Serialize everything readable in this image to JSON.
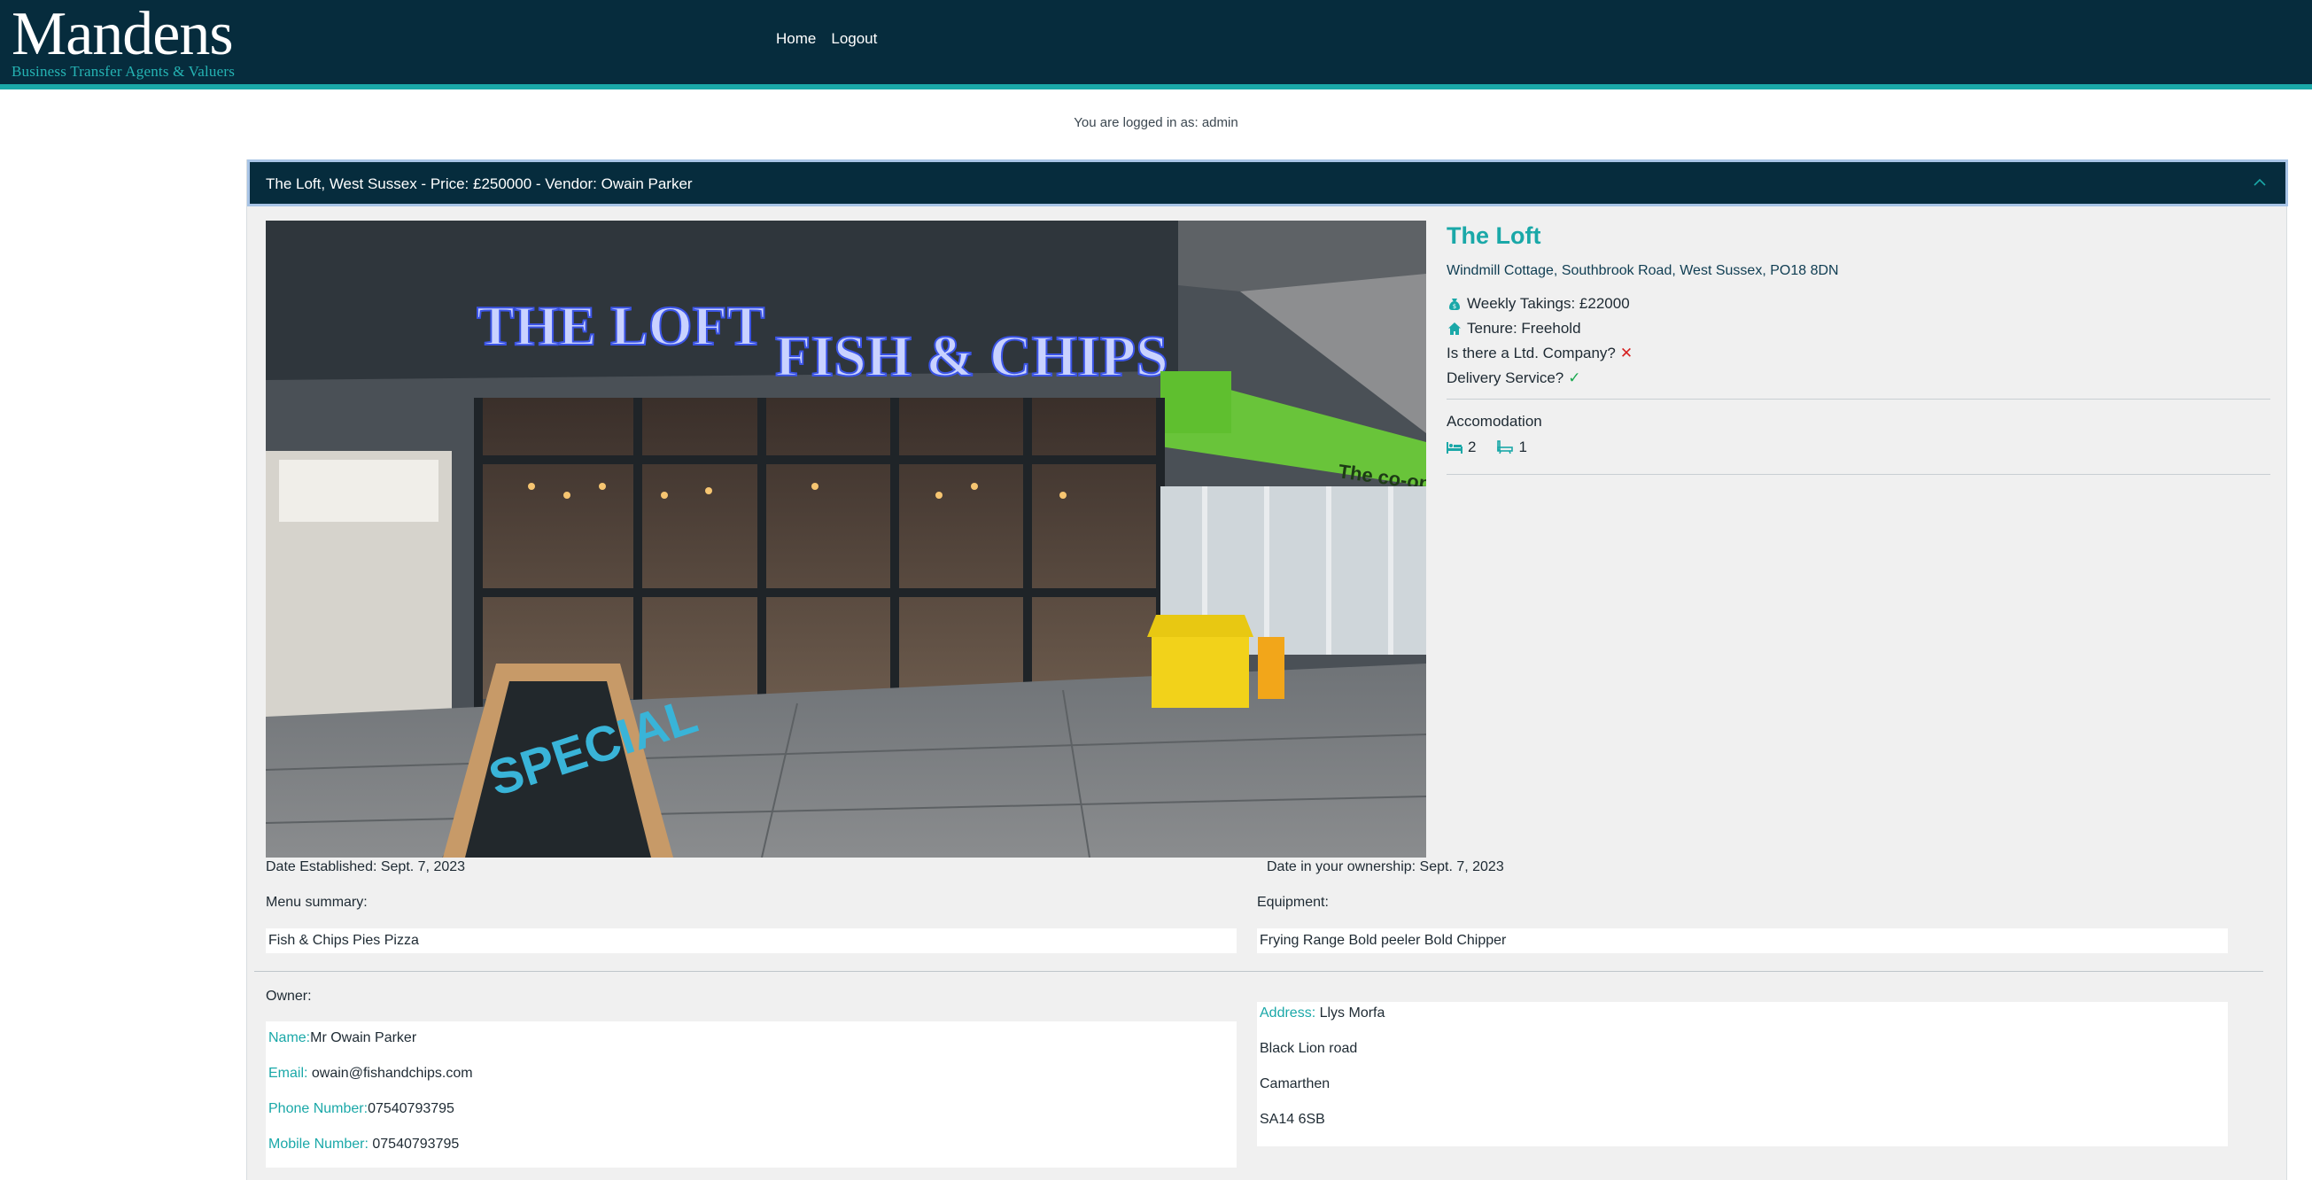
{
  "header": {
    "logo_main": "Mandens",
    "logo_sub": "Business Transfer Agents & Valuers",
    "nav": {
      "home": "Home",
      "logout": "Logout"
    }
  },
  "session": {
    "logged_in_text": "You are logged in as: admin"
  },
  "listing": {
    "panel_title": "The Loft, West Sussex - Price: £250000 - Vendor: Owain Parker",
    "name": "The Loft",
    "address": "Windmill Cottage, Southbrook Road, West Sussex, PO18 8DN",
    "weekly_takings": "Weekly Takings: £22000",
    "tenure": "Tenure: Freehold",
    "ltd_company": "Is there a Ltd. Company?",
    "delivery": "Delivery Service?",
    "accommodation_title": "Accomodation",
    "bedrooms": "2",
    "bathrooms": "1",
    "photo_signage": [
      "THE LOFT",
      "FISH & CHIPS",
      "The co-operative"
    ],
    "date_established": "Date Established: Sept. 7, 2023",
    "date_ownership": "Date in your ownership: Sept. 7, 2023",
    "menu_label": "Menu summary:",
    "menu_value": "Fish & Chips Pies Pizza",
    "equipment_label": "Equipment:",
    "equipment_value": "Frying Range Bold peeler Bold Chipper"
  },
  "owner": {
    "label": "Owner:",
    "name_label": "Name:",
    "name": "Mr Owain Parker",
    "email_label": "Email:",
    "email": " owain@fishandchips.com",
    "phone_label": "Phone Number:",
    "phone": "07540793795",
    "mobile_label": "Mobile Number:",
    "mobile": " 07540793795",
    "address_label": "Address:",
    "address_lines": [
      " Llys Morfa",
      "Black Lion road",
      "Camarthen",
      "SA14 6SB"
    ]
  },
  "colors": {
    "navy": "#062c3d",
    "teal": "#1aa8a8",
    "cross": "#d62020",
    "tick": "#1aa84f"
  }
}
